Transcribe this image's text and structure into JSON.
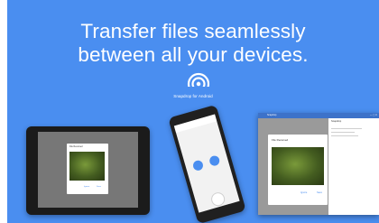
{
  "headline": {
    "line1": "Transfer files seamlessly",
    "line2": "between all your devices."
  },
  "logo": {
    "caption": "Snapdrop for Android",
    "icon": "snapdrop-broadcast-icon"
  },
  "tablet": {
    "dialog_title": "File Received",
    "buttons": [
      "Ignore",
      "Save"
    ]
  },
  "phone": {
    "devices": [
      "",
      ""
    ]
  },
  "laptop": {
    "window_title": "Snapdrop",
    "dialog_title": "File Received",
    "buttons": [
      "Ignore",
      "Save"
    ],
    "side_title": "Snapdrop"
  },
  "colors": {
    "background": "#4a8ef0",
    "accent": "#4a8ef0",
    "photo": "#445d20"
  }
}
